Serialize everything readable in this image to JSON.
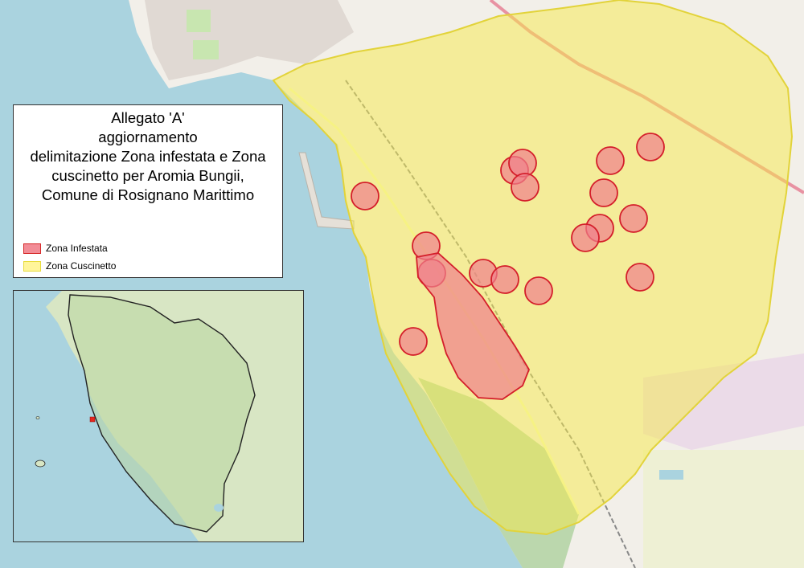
{
  "map": {
    "title_lines": [
      "Allegato 'A'",
      "aggiornamento",
      "delimitazione Zona infestata e Zona",
      "cuscinetto per Aromia Bungii,",
      "Comune di Rosignano Marittimo"
    ],
    "legend": [
      {
        "label": "Zona Infestata",
        "fill": "#f28c96",
        "stroke": "#d62828"
      },
      {
        "label": "Zona Cuscinetto",
        "fill": "#fff59a",
        "stroke": "#e8dc3c"
      }
    ]
  },
  "colors": {
    "sea": "#aad3df",
    "land": "#f2efe9",
    "buffer_fill": "#f5e94a",
    "buffer_stroke": "#e2d33a",
    "infested_fill": "#f0808c",
    "infested_stroke": "#d41e2a",
    "park": "#c8e6b0",
    "forest": "#add19e",
    "industrial": "#ebdbe8",
    "motorway": "#e892a2",
    "railway": "#888888",
    "region_border": "#222222",
    "marker": "#e6261f"
  }
}
